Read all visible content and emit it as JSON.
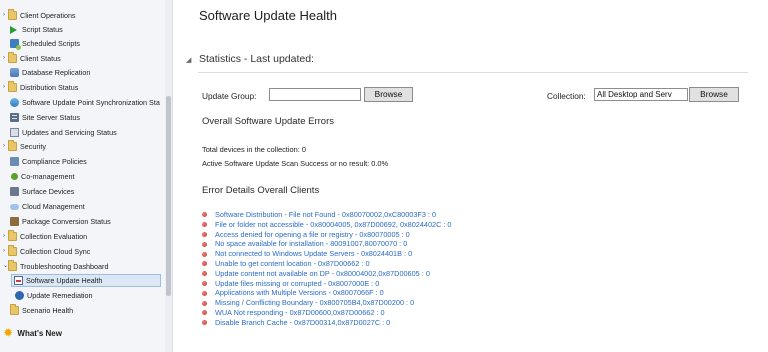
{
  "sidebar": {
    "items": [
      {
        "label": "Client Operations",
        "icon": "folder-icon"
      },
      {
        "label": "Script Status",
        "icon": "script-icon"
      },
      {
        "label": "Scheduled Scripts",
        "icon": "scheduled-scripts-icon"
      },
      {
        "label": "Client Status",
        "icon": "folder-icon"
      },
      {
        "label": "Database Replication",
        "icon": "database-icon"
      },
      {
        "label": "Distribution Status",
        "icon": "folder-icon"
      },
      {
        "label": "Software Update Point Synchronization Sta",
        "icon": "sync-icon"
      },
      {
        "label": "Site Server Status",
        "icon": "server-icon"
      },
      {
        "label": "Updates and Servicing Status",
        "icon": "updates-icon"
      },
      {
        "label": "Security",
        "icon": "folder-icon"
      },
      {
        "label": "Compliance Policies",
        "icon": "compliance-icon"
      },
      {
        "label": "Co-management",
        "icon": "co-management-icon"
      },
      {
        "label": "Surface Devices",
        "icon": "surface-icon"
      },
      {
        "label": "Cloud Management",
        "icon": "cloud-icon"
      },
      {
        "label": "Package Conversion Status",
        "icon": "package-icon"
      },
      {
        "label": "Collection Evaluation",
        "icon": "folder-icon"
      },
      {
        "label": "Collection Cloud Sync",
        "icon": "folder-icon"
      },
      {
        "label": "Troubleshooting Dashboard",
        "icon": "folder-icon"
      },
      {
        "label": "Software Update Health",
        "icon": "health-icon"
      },
      {
        "label": "Update Remediation",
        "icon": "remediation-icon"
      },
      {
        "label": "Scenario Health",
        "icon": "folder-icon"
      }
    ],
    "whats_new": "What's New"
  },
  "main": {
    "title": "Software Update Health",
    "statistics_header": "Statistics - Last updated:",
    "update_group_label": "Update Group:",
    "update_group_value": "",
    "browse_label": "Browse",
    "collection_label": "Collection:",
    "collection_value": "All Desktop and Serv",
    "overall_errors_header": "Overall Software Update Errors",
    "total_devices": "Total devices in the collection: 0",
    "scan_success": "Active Software Update Scan Success or no result: 0.0%",
    "error_details_header": "Error Details Overall Clients",
    "errors": [
      "Software Distribution - File not Found - 0x80070002,0xC80003F3 : 0",
      "File or folder not accessible - 0x80004005, 0x87D00692, 0x8024402C : 0",
      "Access denied for opening a file or registry - 0x80070005 : 0",
      "No space available for installation - 80091007,80070070 : 0",
      "Not connected to Windows Update Servers - 0x8024401B  : 0",
      "Unable to get content location - 0x87D00662  : 0",
      "Update content not available on DP - 0x80004002,0x87D00605 : 0",
      "Update files missing or corrupted - 0x8007000E : 0",
      "Applications with Multiple Versions - 0x8007066F : 0",
      "Missing / Conflicting Boundary - 0x800705B4,0x87D00200 : 0",
      "WUA Not responding - 0x87D00600,0x87D00662 : 0",
      "Disable Branch Cache - 0x87D00314,0x87D0027C : 0"
    ]
  },
  "colors": {
    "link": "#2b6cc4",
    "error_dot": "#c0392b",
    "selected": "#dbe7f5"
  }
}
